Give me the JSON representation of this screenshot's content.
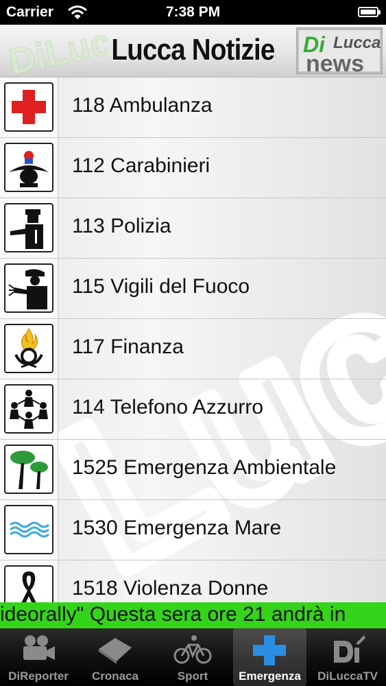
{
  "status_bar": {
    "carrier": "Carrier",
    "time": "7:38 PM"
  },
  "header": {
    "title": "Lucca Notizie",
    "logo_left_text": "DiLucca",
    "logo_right_text": "DiLucca news"
  },
  "items": [
    {
      "label": "118 Ambulanza",
      "icon": "red-cross-icon"
    },
    {
      "label": "112 Carabinieri",
      "icon": "carabiniere-icon"
    },
    {
      "label": "113 Polizia",
      "icon": "police-officer-icon"
    },
    {
      "label": "115 Vigili del Fuoco",
      "icon": "firefighter-icon"
    },
    {
      "label": "117 Finanza",
      "icon": "flame-emblem-icon"
    },
    {
      "label": "114 Telefono Azzurro",
      "icon": "children-circle-icon"
    },
    {
      "label": "1525 Emergenza Ambientale",
      "icon": "trees-icon"
    },
    {
      "label": "1530 Emergenza Mare",
      "icon": "waves-icon"
    },
    {
      "label": "1518 Violenza Donne",
      "icon": "ribbon-icon"
    }
  ],
  "ticker": {
    "text": "ideorally\"  Questa sera ore 21 andrà in"
  },
  "tabs": [
    {
      "label": "DiReporter",
      "icon": "video-camera-icon",
      "active": false
    },
    {
      "label": "Cronaca",
      "icon": "newspaper-icon",
      "active": false
    },
    {
      "label": "Sport",
      "icon": "bicycle-icon",
      "active": false
    },
    {
      "label": "Emergenza",
      "icon": "blue-cross-icon",
      "active": true
    },
    {
      "label": "DiLuccaTV",
      "icon": "diluccatv-logo-icon",
      "active": false
    }
  ],
  "colors": {
    "ticker": "#34d41a",
    "red_cross": "#e02020",
    "blue_cross": "#2a8fe0",
    "tree_green": "#2e9a3a",
    "water": "#35a8e0"
  }
}
